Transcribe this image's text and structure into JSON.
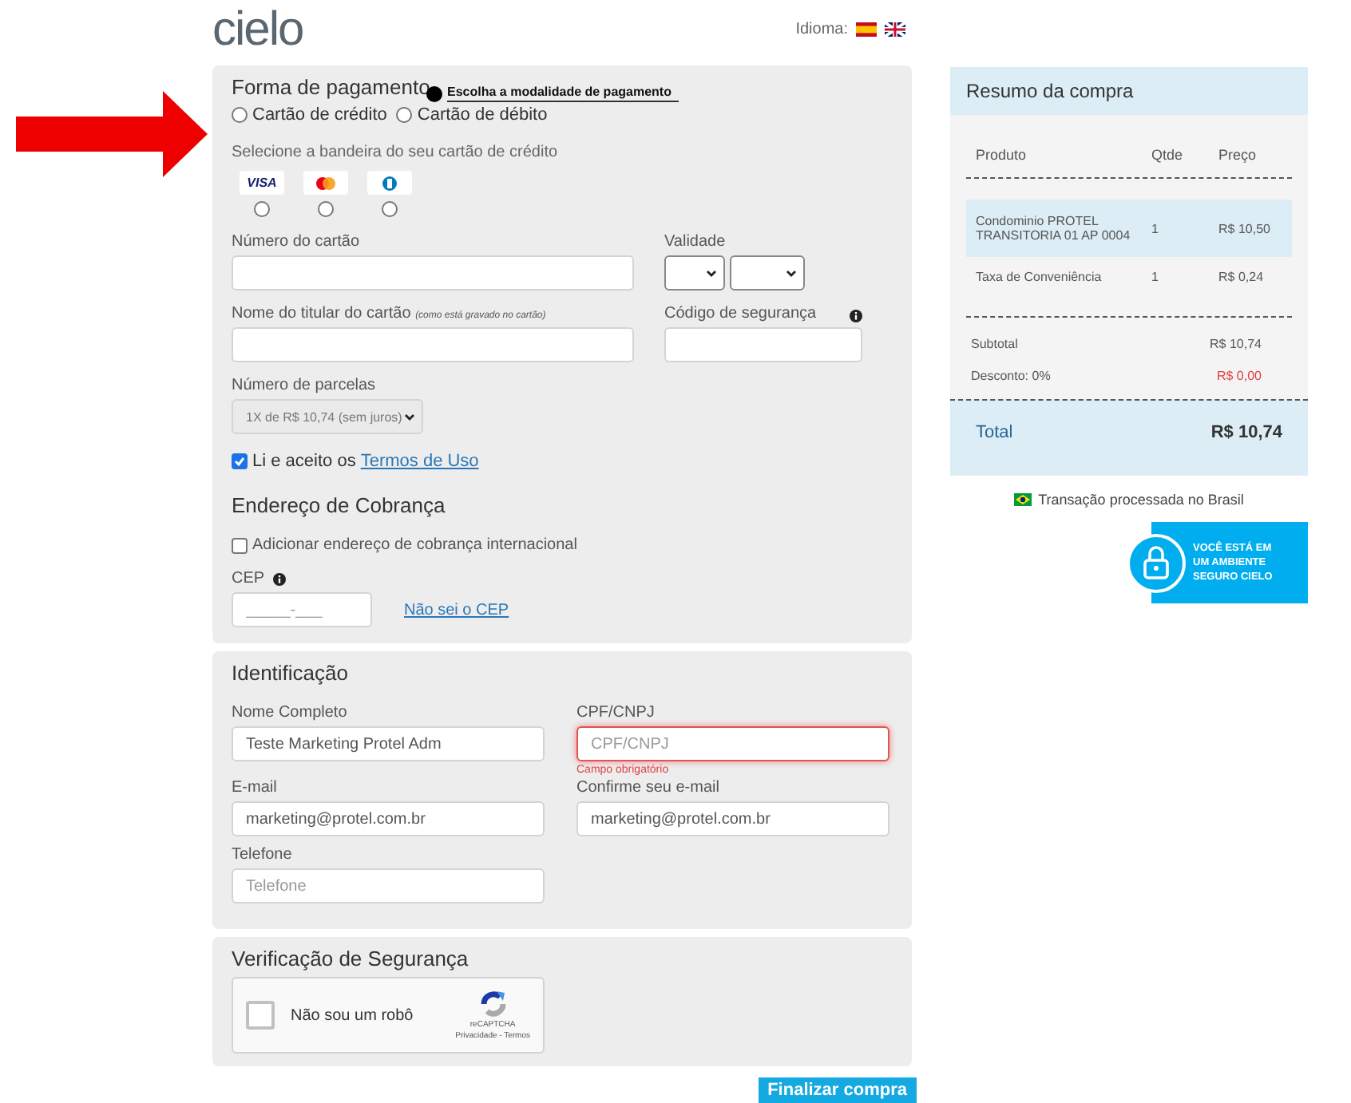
{
  "header": {
    "logo": "cielo",
    "language_label": "Idioma:",
    "flags": [
      {
        "kind": "es"
      },
      {
        "kind": "gb"
      }
    ]
  },
  "annotation": {
    "text": "Escolha a modalidade de pagamento"
  },
  "payment": {
    "title": "Forma de pagamento",
    "methods": [
      {
        "label": "Cartão de crédito",
        "selected": false
      },
      {
        "label": "Cartão de débito",
        "selected": false
      }
    ],
    "brand_prompt": "Selecione a bandeira do seu cartão de crédito",
    "brands": [
      {
        "kind": "visa",
        "label": "VISA",
        "selected": false
      },
      {
        "kind": "mastercard",
        "selected": false
      },
      {
        "kind": "diners",
        "selected": false
      }
    ],
    "card_number": {
      "label": "Número do cartão"
    },
    "validity": {
      "label": "Validade"
    },
    "holder": {
      "label": "Nome do titular do cartão",
      "note": "(como está gravado no cartão)"
    },
    "security_code": {
      "label": "Código de segurança"
    },
    "installments": {
      "label": "Número de parcelas",
      "value": "1X de R$ 10,74 (sem juros)",
      "disabled": true
    },
    "terms": {
      "checked": true,
      "text": "Li e aceito os",
      "link": "Termos de Uso"
    }
  },
  "billing": {
    "title": "Endereço de Cobrança",
    "international": {
      "checked": false,
      "label": "Adicionar endereço de cobrança internacional"
    },
    "cep": {
      "label": "CEP",
      "placeholder": "_____-___",
      "link": "Não sei o CEP"
    }
  },
  "identification": {
    "title": "Identificação",
    "fields": [
      {
        "label": "Nome Completo",
        "value": "Teste Marketing Protel Adm",
        "invalid": false
      },
      {
        "label": "CPF/CNPJ",
        "placeholder": "CPF/CNPJ",
        "invalid": true,
        "error": "Campo obrigatório"
      },
      {
        "label": "E-mail",
        "value": "marketing@protel.com.br",
        "invalid": false
      },
      {
        "label": "Confirme seu e-mail",
        "value": "marketing@protel.com.br",
        "invalid": false
      },
      {
        "label": "Telefone",
        "placeholder": "Telefone",
        "invalid": false
      }
    ]
  },
  "security": {
    "title": "Verificação de Segurança",
    "captcha": {
      "checked": false,
      "label": "Não sou um robô",
      "brand": "reCAPTCHA",
      "links": "Privacidade - Termos"
    }
  },
  "submit": "Finalizar compra",
  "summary": {
    "title": "Resumo da compra",
    "columns": [
      "Produto",
      "Qtde",
      "Preço"
    ],
    "items": [
      {
        "name": "Condominio PROTEL TRANSITORIA 01 AP 0004",
        "qty": "1",
        "price": "R$ 10,50",
        "selected": true
      },
      {
        "name": "Taxa de Conveniência",
        "qty": "1",
        "price": "R$ 0,24",
        "selected": false
      }
    ],
    "subtotal": {
      "label": "Subtotal",
      "value": "R$ 10,74"
    },
    "discount": {
      "label": "Desconto: 0%",
      "value": "R$ 0,00"
    },
    "total": {
      "label": "Total",
      "value": "R$ 10,74"
    },
    "country_note": "Transação processada no Brasil",
    "badge_lines": [
      "VOCÊ ESTÁ EM",
      "UM AMBIENTE",
      "SEGURO CIELO"
    ]
  }
}
